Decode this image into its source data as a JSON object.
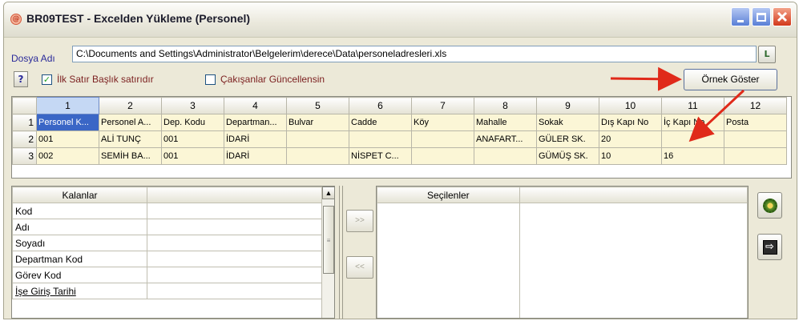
{
  "window": {
    "title": "BR09TEST - Excelden Yükleme (Personel)",
    "app_icon_glyph": "@"
  },
  "file": {
    "label": "Dosya Adı",
    "path": "C:\\Documents and Settings\\Administrator\\Belgelerim\\derece\\Data\\personeladresleri.xls",
    "browse_glyph": "L"
  },
  "options": {
    "help_glyph": "?",
    "first_row_header": "İlk Satır Başlık satırıdır",
    "first_row_checked": "✓",
    "overwrite": "Çakışanlar Güncellensin",
    "preview_button": "Örnek Göster"
  },
  "grid": {
    "columns": [
      "1",
      "2",
      "3",
      "4",
      "5",
      "6",
      "7",
      "8",
      "9",
      "10",
      "11",
      "12"
    ],
    "rows": [
      {
        "num": "1",
        "cells": [
          "Personel K...",
          "Personel A...",
          "Dep. Kodu",
          "Departman...",
          "Bulvar",
          "Cadde",
          "Köy",
          "Mahalle",
          "Sokak",
          "Dış Kapı No",
          "İç Kapı No",
          "Posta"
        ]
      },
      {
        "num": "2",
        "cells": [
          "001",
          "ALİ TUNÇ",
          "001",
          "İDARİ",
          "",
          "",
          "",
          "ANAFART...",
          "GÜLER SK.",
          "20",
          "",
          ""
        ]
      },
      {
        "num": "3",
        "cells": [
          "002",
          "SEMİH BA...",
          "001",
          "İDARİ",
          "",
          "NİSPET C...",
          "",
          "",
          "GÜMÜŞ SK.",
          "10",
          "16",
          ""
        ]
      }
    ]
  },
  "remaining": {
    "header": "Kalanlar",
    "items": [
      "Kod",
      "Adı",
      "Soyadı",
      "Departman Kod",
      "Görev Kod",
      "İşe Giriş Tarihi"
    ]
  },
  "selected": {
    "header": "Seçilenler"
  },
  "move_buttons": {
    "add": ">>",
    "remove": "<<"
  },
  "scroll_glyphs": {
    "up": "▲",
    "grip": "≡"
  },
  "exit_glyph": "⇨",
  "colors": {
    "title_bar_close": "#d2381a",
    "annotation_arrow": "#e02a1a",
    "grid_cell_bg": "#fbf6d6",
    "selected_cell_bg": "#3a66c6"
  }
}
